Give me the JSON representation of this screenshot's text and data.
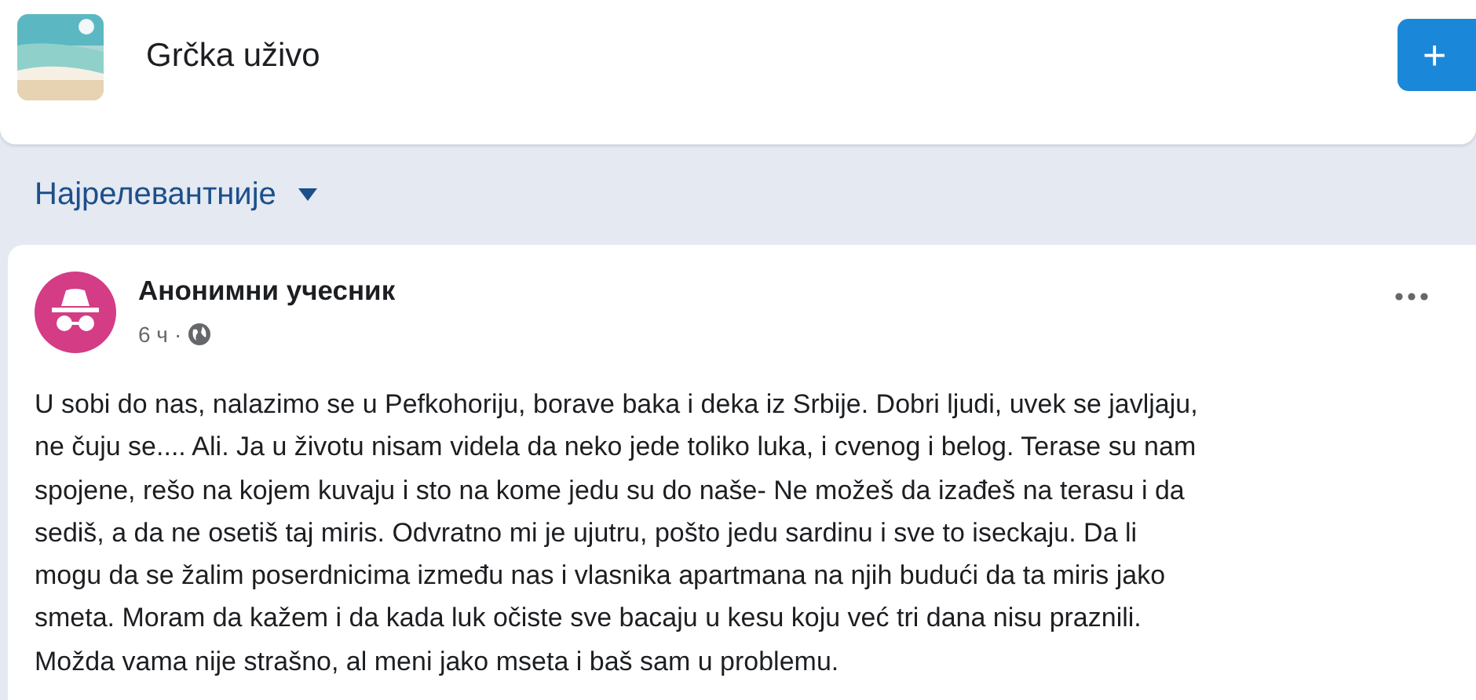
{
  "group": {
    "name": "Grčka uživo",
    "join_button": "+"
  },
  "sort": {
    "label": "Најрелевантније"
  },
  "post": {
    "author": "Анонимни учесник",
    "time": "6 ч",
    "dot": "·",
    "text": "U sobi do nas, nalazimo se u Pefkohoriju, borave baka i deka iz Srbije. Dobri ljudi, uvek se javljaju,\nne čuju se.... Ali. Ja u životu nisam videla da neko jede toliko luka, i cvenog i belog. Terase su nam\nspojene, rešo na kojem kuvaju i sto na kome jedu su do naše- Ne možeš da izađeš na terasu i da\nsediš, a da ne osetiš taj miris. Odvratno mi je ujutru, pošto jedu sardinu i sve to iseckaju. Da li\nmogu da se žalim poserdnicima između nas i vlasnika apartmana na njih budući da ta miris jako\nsmeta. Moram da kažem i da kada luk očiste sve bacaju u kesu koju već tri dana nisu praznili.\nMožda vama nije strašno, al meni jako mseta i baš sam u problemu."
  }
}
